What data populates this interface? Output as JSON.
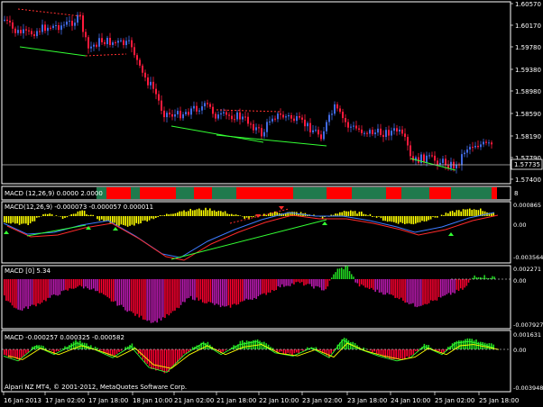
{
  "colors": {
    "background": "#000000",
    "frame": "#ffffff",
    "bull_candle": "#4169e1",
    "bear_candle": "#ff1a3c",
    "macd_bar_hist": "#ffff00",
    "macd_line_blue": "#3d7bff",
    "macd_line_red": "#ff2a2a",
    "trend_green": "#33ff33",
    "hist_red": "#ff0030",
    "hist_magenta": "#c21bb6",
    "hist_green": "#22dd22",
    "ribbon_green": "#1f7a4d",
    "ribbon_red": "#ff0000"
  },
  "main_panel": {
    "price_labels": [
      "1.60570",
      "1.60170",
      "1.59780",
      "1.59380",
      "1.58980",
      "1.58590",
      "1.58190",
      "1.57790",
      "1.57400"
    ],
    "current_price": "1.57735"
  },
  "ribbon_panel": {
    "title": "MACD (12,26,9) 0.0000 2.0000",
    "right_label": "8"
  },
  "macd1_panel": {
    "title": "MACD(12,26,9) -0.000073 -0.000057 0.000011",
    "labels": [
      "0.000865",
      "0.00",
      "-0.003564"
    ]
  },
  "macd2_panel": {
    "title": "MACD [0] 5.34",
    "labels": [
      "0.002271",
      "0.00",
      "-0.007927"
    ]
  },
  "macd3_panel": {
    "title": "MACD -0.000257 0.000325 -0.000582",
    "labels": [
      "0.001631",
      "0.00",
      "-0.003948"
    ]
  },
  "time_axis": {
    "labels": [
      "16 Jan 2013",
      "17 Jan 02:00",
      "17 Jan 18:00",
      "18 Jan 10:00",
      "21 Jan 02:00",
      "21 Jan 18:00",
      "22 Jan 10:00",
      "23 Jan 02:00",
      "23 Jan 18:00",
      "24 Jan 10:00",
      "25 Jan 02:00",
      "25 Jan 18:00"
    ]
  },
  "copyright": "Alpari NZ MT4, © 2001-2012, MetaQuotes Software Corp."
}
